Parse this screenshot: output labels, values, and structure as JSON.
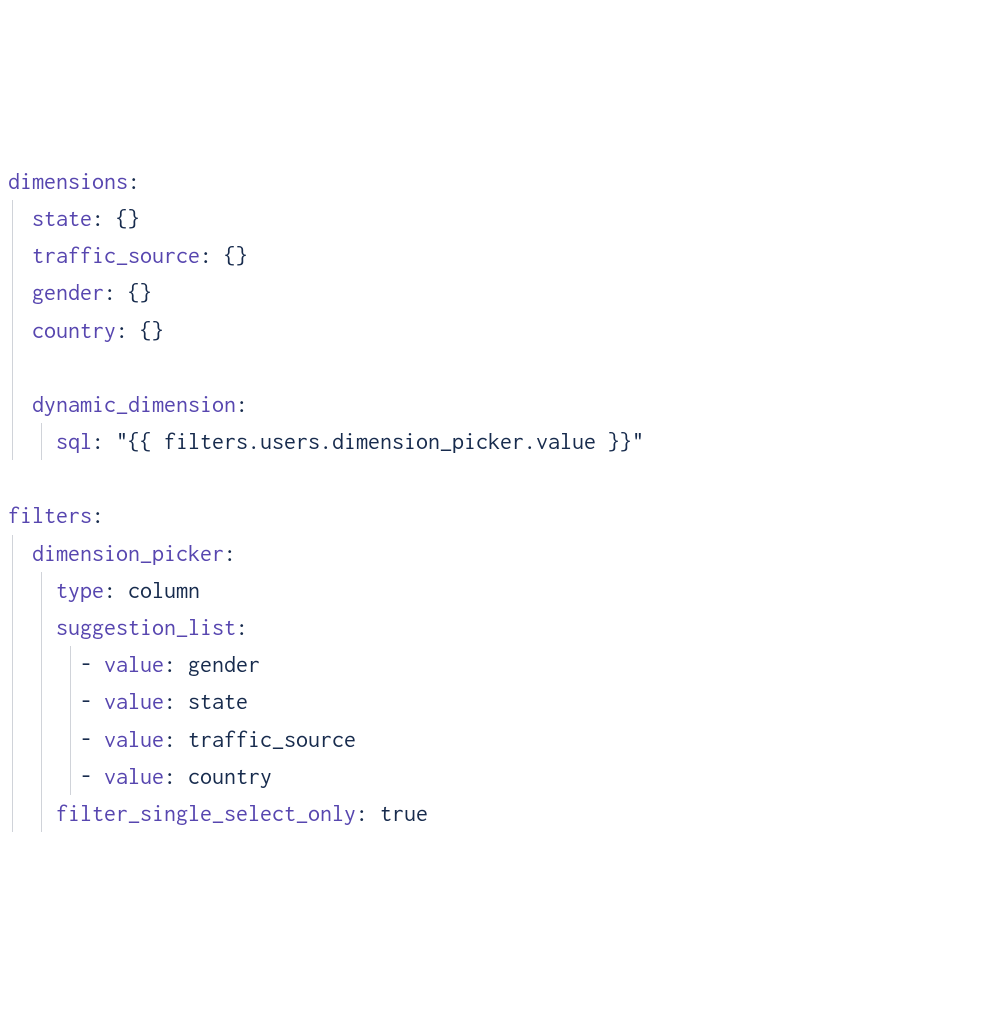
{
  "code": {
    "colon": ":",
    "space": " ",
    "dash": "- ",
    "empty_obj": "{}",
    "dimensions_key": "dimensions",
    "dimensions": {
      "state": "state",
      "traffic_source": "traffic_source",
      "gender": "gender",
      "country": "country",
      "dynamic_dimension": "dynamic_dimension",
      "sql_key": "sql",
      "sql_value": "\"{{ filters.users.dimension_picker.value }}\""
    },
    "filters_key": "filters",
    "filters": {
      "dimension_picker": "dimension_picker",
      "type_key": "type",
      "type_value": "column",
      "suggestion_list": "suggestion_list",
      "value_key": "value",
      "items": {
        "i0": "gender",
        "i1": "state",
        "i2": "traffic_source",
        "i3": "country"
      },
      "filter_single_select_only_key": "filter_single_select_only",
      "filter_single_select_only_value": "true"
    }
  }
}
